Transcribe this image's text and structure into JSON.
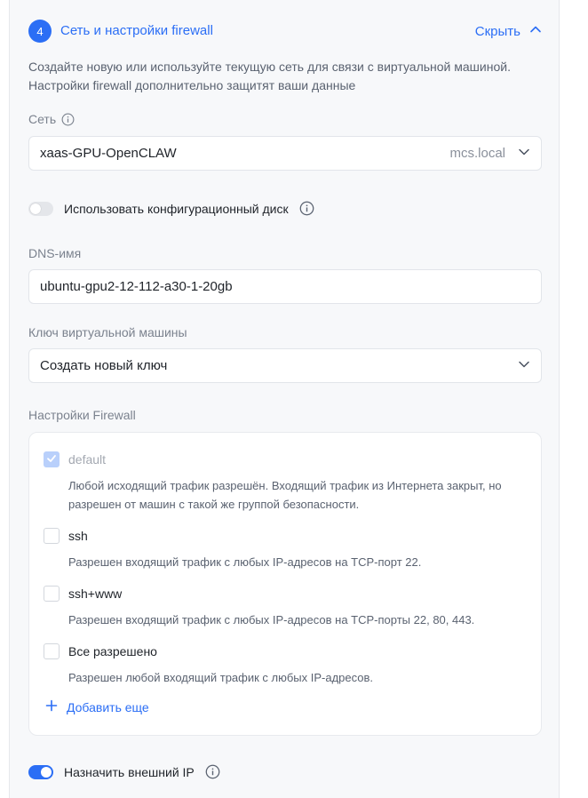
{
  "section": {
    "step_number": "4",
    "title": "Сеть и настройки firewall",
    "hide_label": "Скрыть",
    "description": "Создайте новую или используйте текущую сеть для связи с виртуальной машиной. Настройки firewall дополнительно защитят ваши данные"
  },
  "network": {
    "label": "Сеть",
    "value": "xaas-GPU-OpenCLAW",
    "domain": "mcs.local"
  },
  "config_disk": {
    "label": "Использовать конфигурационный диск",
    "enabled": false
  },
  "dns": {
    "label": "DNS-имя",
    "value": "ubuntu-gpu2-12-112-a30-1-20gb"
  },
  "vm_key": {
    "label": "Ключ виртуальной машины",
    "value": "Создать новый ключ"
  },
  "firewall": {
    "label": "Настройки Firewall",
    "items": [
      {
        "name": "default",
        "checked": true,
        "disabled": true,
        "description": "Любой исходящий трафик разрешён. Входящий трафик из Интернета закрыт, но разрешен от машин с такой же группой безопасности."
      },
      {
        "name": "ssh",
        "checked": false,
        "disabled": false,
        "description": "Разрешен входящий трафик с любых IP-адресов на TCP-порт 22."
      },
      {
        "name": "ssh+www",
        "checked": false,
        "disabled": false,
        "description": "Разрешен входящий трафик с любых IP-адресов на TCP-порты 22, 80, 443."
      },
      {
        "name": "Все разрешено",
        "checked": false,
        "disabled": false,
        "description": "Разрешен любой входящий трафик с любых IP-адресов."
      }
    ],
    "add_more_label": "Добавить еще"
  },
  "external_ip": {
    "label": "Назначить внешний IP",
    "enabled": true
  },
  "colors": {
    "accent": "#2b6ef5",
    "panel_bg": "#f7f8fa",
    "muted_text": "#7b828e"
  },
  "icons": [
    "chevron-up-icon",
    "info-icon",
    "chevron-down-icon",
    "checkmark-icon",
    "plus-icon"
  ]
}
